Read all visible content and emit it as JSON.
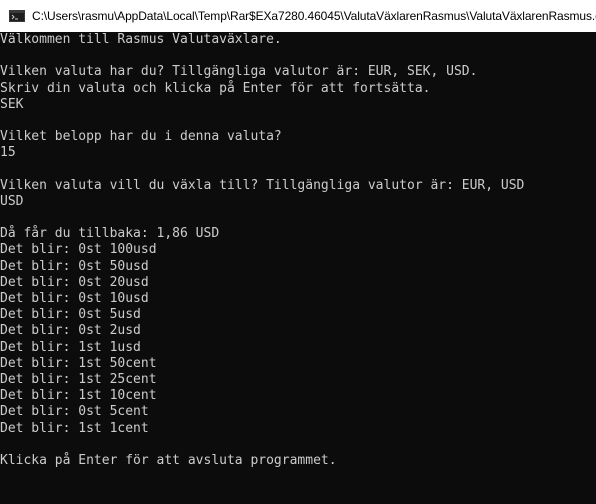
{
  "window": {
    "title": "C:\\Users\\rasmu\\AppData\\Local\\Temp\\Rar$EXa7280.46045\\ValutaVäxlarenRasmus\\ValutaVäxlarenRasmus.exe",
    "icon": "console-app-icon"
  },
  "console": {
    "lines": [
      "Välkommen till Rasmus Valutaväxlare.",
      "",
      "Vilken valuta har du? Tillgängliga valutor är: EUR, SEK, USD.",
      "Skriv din valuta och klicka på Enter för att fortsätta.",
      "SEK",
      "",
      "Vilket belopp har du i denna valuta?",
      "15",
      "",
      "Vilken valuta vill du växla till? Tillgängliga valutor är: EUR, USD",
      "USD",
      "",
      "Då får du tillbaka: 1,86 USD",
      "Det blir: 0st 100usd",
      "Det blir: 0st 50usd",
      "Det blir: 0st 20usd",
      "Det blir: 0st 10usd",
      "Det blir: 0st 5usd",
      "Det blir: 0st 2usd",
      "Det blir: 1st 1usd",
      "Det blir: 1st 50cent",
      "Det blir: 1st 25cent",
      "Det blir: 1st 10cent",
      "Det blir: 0st 5cent",
      "Det blir: 1st 1cent",
      "",
      "Klicka på Enter för att avsluta programmet."
    ]
  },
  "colors": {
    "console_background": "#0c0c0c",
    "console_text": "#cccccc",
    "titlebar_background": "#ffffff"
  }
}
